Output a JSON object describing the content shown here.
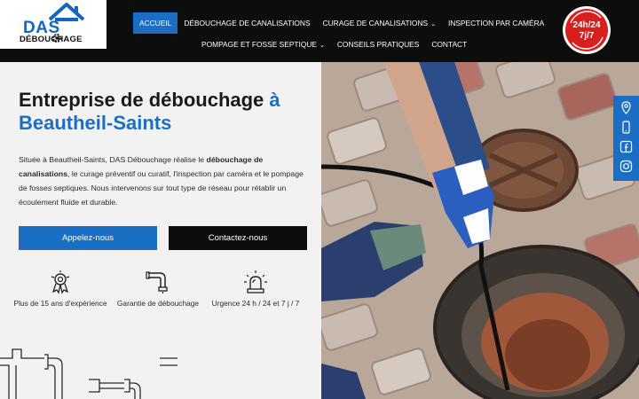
{
  "logo": {
    "text_top": "DAS",
    "text_bottom": "DÉBOUCHAGE"
  },
  "nav": {
    "items": [
      {
        "label": "ACCUEIL",
        "active": true,
        "dropdown": false
      },
      {
        "label": "DÉBOUCHAGE DE CANALISATIONS",
        "active": false,
        "dropdown": false
      },
      {
        "label": "CURAGE DE CANALISATIONS",
        "active": false,
        "dropdown": true
      },
      {
        "label": "INSPECTION PAR CAMÉRA",
        "active": false,
        "dropdown": false
      }
    ],
    "items_row2": [
      {
        "label": "POMPAGE ET FOSSE SEPTIQUE",
        "active": false,
        "dropdown": true
      },
      {
        "label": "CONSEILS PRATIQUES",
        "active": false,
        "dropdown": false
      },
      {
        "label": "CONTACT",
        "active": false,
        "dropdown": false
      }
    ]
  },
  "badge": {
    "line1": "24h/24",
    "line2": "7j/7"
  },
  "hero": {
    "title_part1": "Entreprise de débouchage ",
    "title_highlight": "à",
    "title_part2": "Beautheil-Saints",
    "text_1": "Située à Beautheil-Saints, DAS Débouchage réalise le ",
    "text_bold": "débouchage de canalisations",
    "text_2": ", le curage préventif ou curatif, l'inspection par caméra et le pompage de fosses septiques. Nous intervenons sur tout type de réseau pour rétablir un écoulement fluide et durable.",
    "btn_call": "Appelez-nous",
    "btn_contact": "Contactez-nous"
  },
  "features": [
    {
      "icon": "award-medal-icon",
      "label": "Plus de 15 ans d'expérience"
    },
    {
      "icon": "pipe-icon",
      "label": "Garantie de débouchage"
    },
    {
      "icon": "emergency-siren-icon",
      "label": "Urgence 24 h / 24 et 7 j / 7"
    }
  ],
  "side_icons": [
    "location-pin-icon",
    "mobile-phone-icon",
    "facebook-icon",
    "instagram-icon"
  ],
  "colors": {
    "accent": "#1a6fc4",
    "header": "#0d0d0d",
    "badge": "#d91e1e"
  }
}
